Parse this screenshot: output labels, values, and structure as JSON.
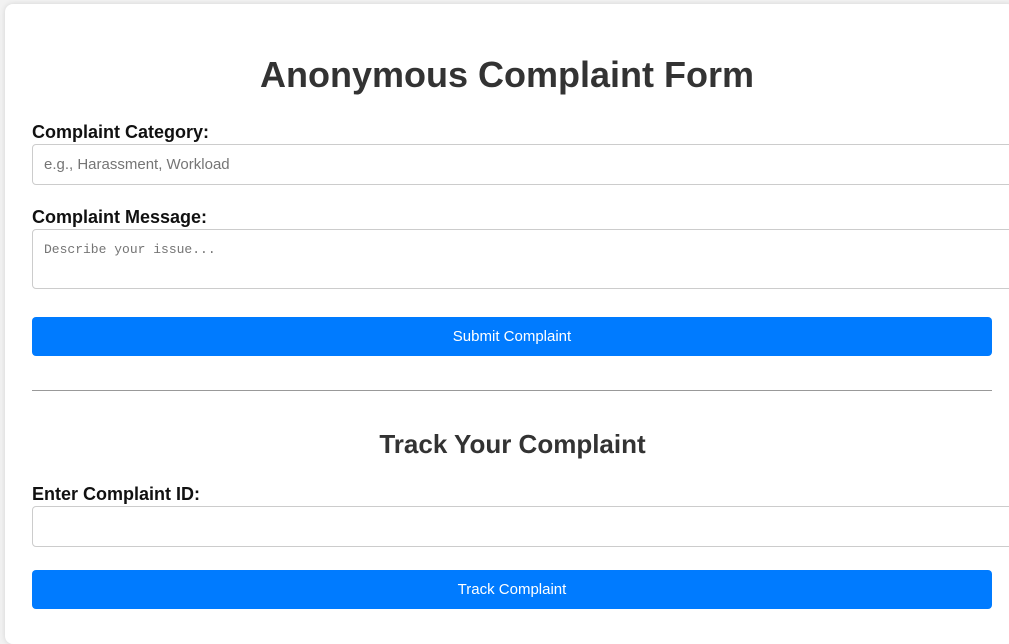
{
  "submit_form": {
    "title": "Anonymous Complaint Form",
    "category_label": "Complaint Category:",
    "category_placeholder": "e.g., Harassment, Workload",
    "category_value": "",
    "message_label": "Complaint Message:",
    "message_placeholder": "Describe your issue...",
    "message_value": "",
    "submit_label": "Submit Complaint"
  },
  "track_form": {
    "title": "Track Your Complaint",
    "id_label": "Enter Complaint ID:",
    "id_placeholder": "",
    "id_value": "",
    "track_label": "Track Complaint"
  },
  "colors": {
    "accent": "#007bff",
    "heading": "#333333",
    "border": "#cccccc"
  }
}
